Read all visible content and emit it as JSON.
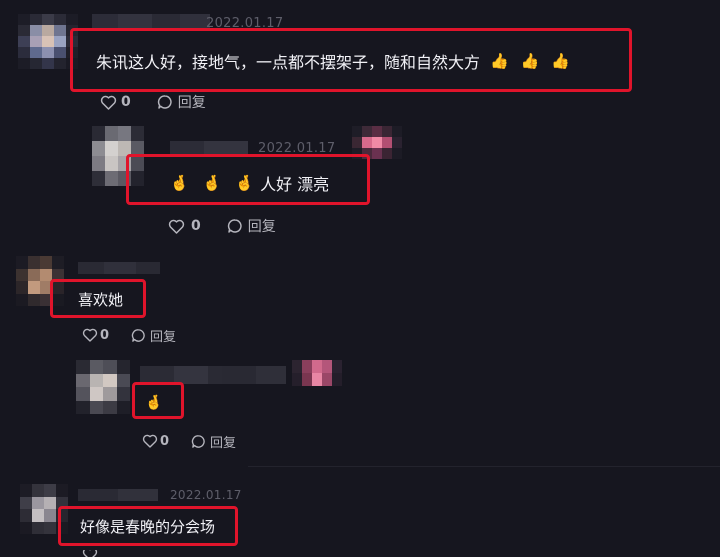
{
  "comments": [
    {
      "date": "2022.01.17",
      "text": "朱讯这人好，接地气，一点都不摆架子，随和自然大方",
      "emojis": [
        "thumbs-up-icon",
        "thumbs-up-icon",
        "thumbs-up-icon"
      ],
      "likes": "0",
      "reply_label": "回复"
    },
    {
      "date": "2022.01.17",
      "text": "人好 漂亮",
      "emojis": [
        "finger-heart-icon",
        "finger-heart-icon",
        "finger-heart-icon"
      ],
      "likes": "0",
      "reply_label": "回复"
    },
    {
      "text": "喜欢她",
      "likes": "0",
      "reply_label": "回复"
    },
    {
      "emojis": [
        "finger-heart-icon"
      ],
      "likes": "0",
      "reply_label": "回复"
    },
    {
      "date": "2022.01.17",
      "text": "好像是春晚的分会场"
    }
  ],
  "colors": {
    "highlight": "#e0142b",
    "background": "#16161f",
    "muted_text": "#b5b5bd"
  }
}
